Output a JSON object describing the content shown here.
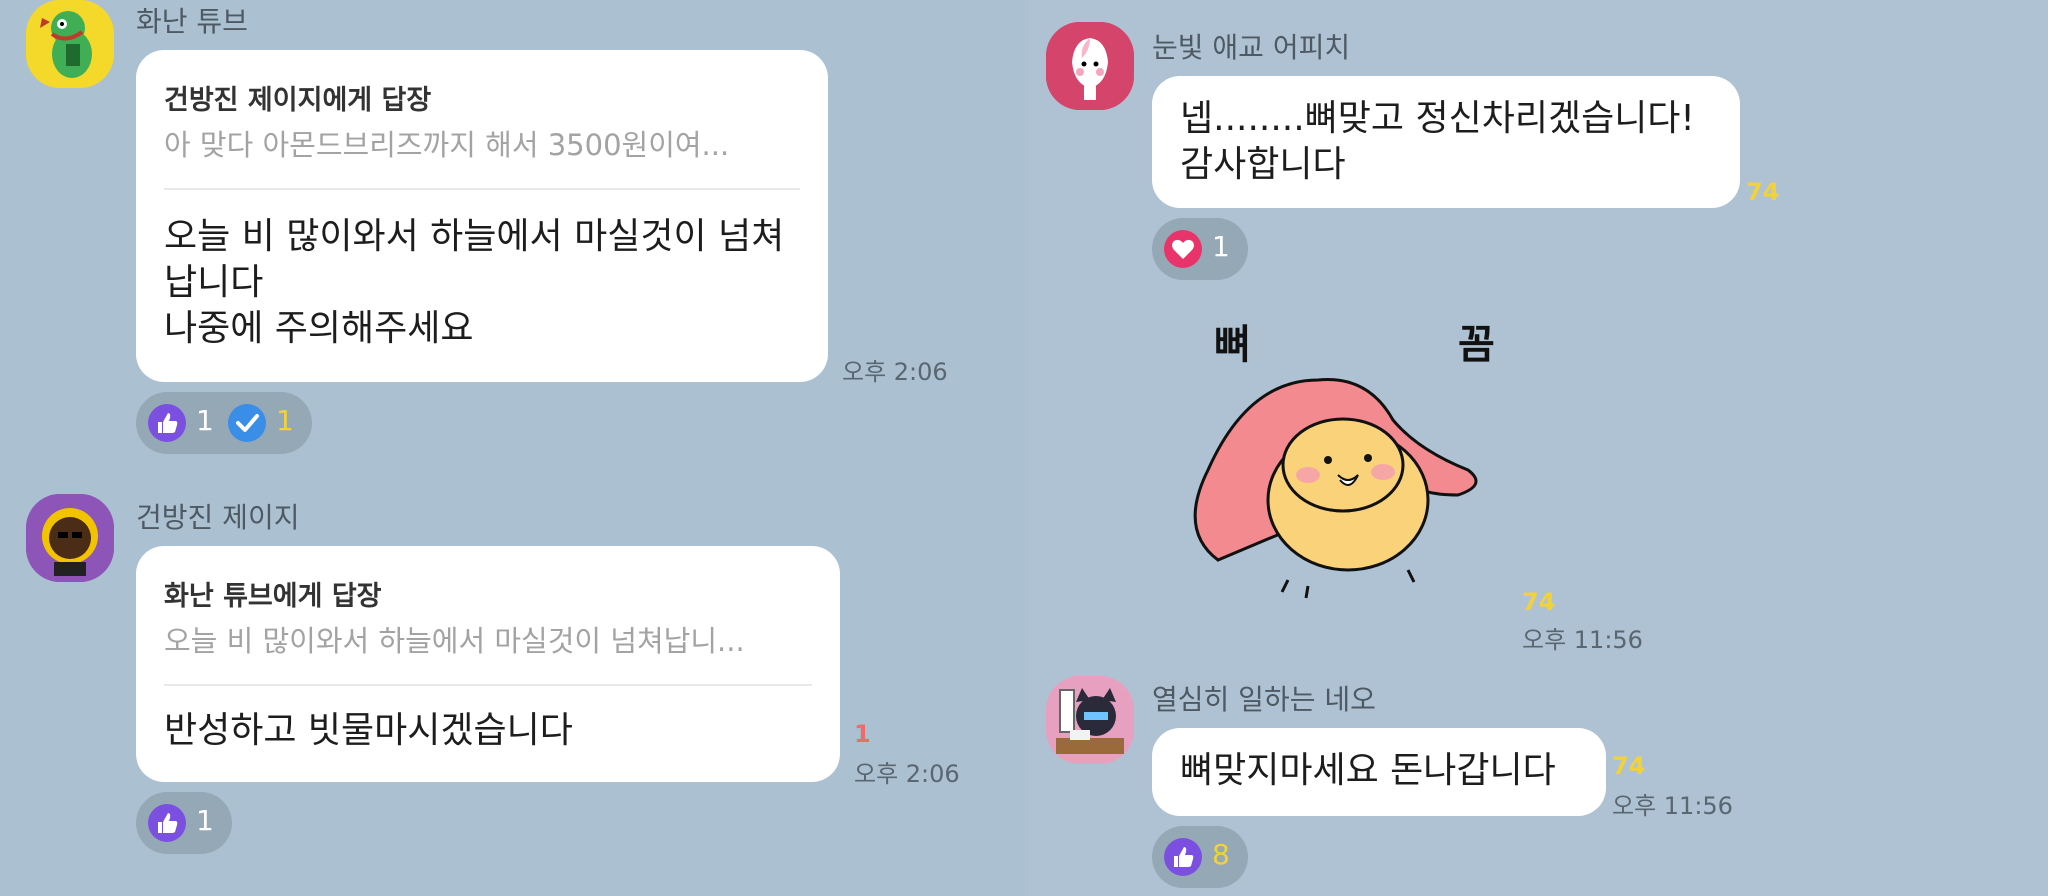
{
  "left": {
    "messages": [
      {
        "sender": "화난 튜브",
        "reply_to": "건방진 제이지에게 답장",
        "quote": "아 맞다 아몬드브리즈까지 해서 3500원이여...",
        "lines": [
          "오늘 비 많이와서 하늘에서 마실것이 넘쳐",
          "납니다",
          "나중에 주의해주세요"
        ],
        "time": "오후 2:06",
        "reactions": [
          {
            "icon": "thumbs-up-icon",
            "count": "1"
          },
          {
            "icon": "check-icon",
            "count": "1"
          }
        ]
      },
      {
        "sender": "건방진 제이지",
        "reply_to": "화난 튜브에게 답장",
        "quote": "오늘 비 많이와서 하늘에서 마실것이 넘쳐납니...",
        "lines": [
          "반성하고 빗물마시겠습니다"
        ],
        "unread": "1",
        "time": "오후 2:06",
        "reactions": [
          {
            "icon": "thumbs-up-icon",
            "count": "1"
          }
        ]
      }
    ]
  },
  "right": {
    "messages": [
      {
        "sender": "눈빛 애교 어피치",
        "lines": [
          "넵........뼈맞고 정신차리겠습니다!",
          "감사합니다"
        ],
        "unread": "74",
        "reactions": [
          {
            "icon": "heart-icon",
            "count": "1"
          }
        ]
      },
      {
        "sticker_text": [
          "뼈",
          "꼼"
        ],
        "unread": "74",
        "time": "오후 11:56"
      },
      {
        "sender": "열심히 일하는 네오",
        "lines": [
          "뼈맞지마세요 돈나갑니다"
        ],
        "unread": "74",
        "time": "오후 11:56",
        "reactions": [
          {
            "icon": "thumbs-up-icon",
            "count": "8"
          }
        ]
      }
    ]
  },
  "colors": {
    "background_left": "#abc1d2",
    "background_right": "#aec2d3",
    "bubble": "#ffffff",
    "unread": "#f2d23b",
    "unread_red": "#f06c6c",
    "reaction_pill": "#94a8b6",
    "thumbs_up": "#7b4fe0",
    "check": "#3a8ee8",
    "heart": "#e8346a"
  }
}
